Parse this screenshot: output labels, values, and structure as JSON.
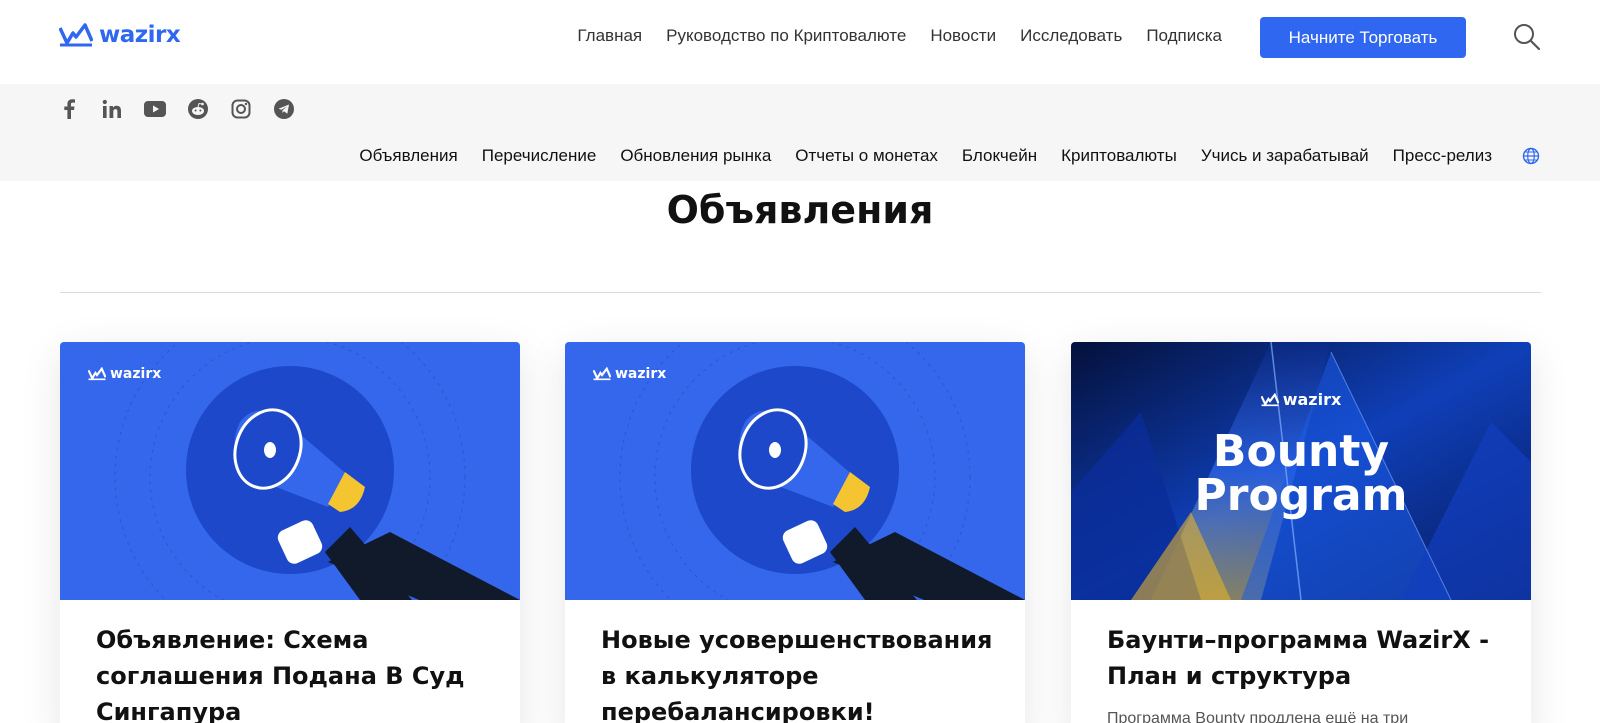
{
  "brand": {
    "name": "wazirx",
    "color": "#3067F0"
  },
  "nav": {
    "items": [
      "Главная",
      "Руководство по Криптовалюте",
      "Новости",
      "Исследовать",
      "Подписка"
    ],
    "cta": "Начните Торговать"
  },
  "socials": [
    "facebook-icon",
    "linkedin-icon",
    "youtube-icon",
    "reddit-icon",
    "instagram-icon",
    "telegram-icon"
  ],
  "categories": [
    "Объявления",
    "Перечисление",
    "Обновления рынка",
    "Отчеты о монетах",
    "Блокчейн",
    "Криптовалюты",
    "Учись и зарабатывай",
    "Пресс-релиз"
  ],
  "page": {
    "title": "Объявления"
  },
  "cards": [
    {
      "title": "Объявление: Схема соглашения Подана В Суд Сингапура",
      "image_brand": "wazirx",
      "image": "megaphone-illustration",
      "excerpt": ""
    },
    {
      "title": "Новые усовершенствования в калькуляторе перебалансировки!",
      "image_brand": "wazirx",
      "image": "megaphone-illustration",
      "excerpt": ""
    },
    {
      "title": "Баунти–программа WazirX - План и структура",
      "image_brand": "wazirx",
      "image_text": "Bounty Program",
      "excerpt": "Программа Bounty продлена ещё на три"
    }
  ]
}
